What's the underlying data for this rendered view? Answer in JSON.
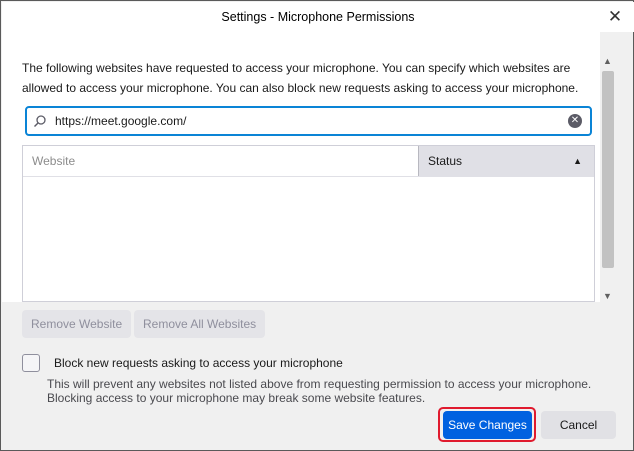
{
  "window": {
    "title": "Settings - Microphone Permissions",
    "close_symbol": "✕"
  },
  "description": "The following websites have requested to access your microphone. You can specify which websites are allowed to access your microphone. You can also block new requests asking to access your microphone.",
  "search": {
    "value": "https://meet.google.com/",
    "icon": "search-icon",
    "clear_icon": "clear-icon"
  },
  "table": {
    "columns": [
      "Website",
      "Status"
    ],
    "sorted_column": "Status",
    "sort_direction": "ascending",
    "rows": []
  },
  "buttons": {
    "remove_website": "Remove Website",
    "remove_all": "Remove All Websites",
    "save": "Save Changes",
    "cancel": "Cancel"
  },
  "block_requests": {
    "label": "Block new requests asking to access your microphone",
    "checked": false,
    "hint": "This will prevent any websites not listed above from requesting permission to access your microphone. Blocking access to your microphone may break some website features."
  },
  "colors": {
    "accent": "#0061e0",
    "focus_border": "#0a84d6",
    "highlight_outline": "#e01a2e"
  }
}
